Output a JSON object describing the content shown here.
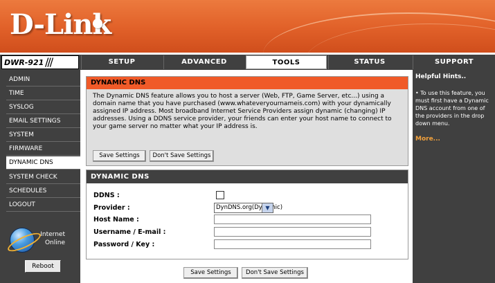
{
  "brand": {
    "logo": "D-Link"
  },
  "model": {
    "label": "DWR-921",
    "bars": "///"
  },
  "tabs": [
    {
      "label": "SETUP"
    },
    {
      "label": "ADVANCED"
    },
    {
      "label": "TOOLS"
    },
    {
      "label": "STATUS"
    },
    {
      "label": "SUPPORT"
    }
  ],
  "sidebar": {
    "items": [
      {
        "label": "ADMIN"
      },
      {
        "label": "TIME"
      },
      {
        "label": "SYSLOG"
      },
      {
        "label": "EMAIL SETTINGS"
      },
      {
        "label": "SYSTEM"
      },
      {
        "label": "FIRMWARE"
      },
      {
        "label": "DYNAMIC DNS"
      },
      {
        "label": "SYSTEM CHECK"
      },
      {
        "label": "SCHEDULES"
      },
      {
        "label": "LOGOUT"
      }
    ],
    "active": "DYNAMIC DNS",
    "internet_status_line1": "Internet",
    "internet_status_line2": "Online",
    "reboot_label": "Reboot"
  },
  "intro": {
    "title": "DYNAMIC DNS",
    "description": "The Dynamic DNS feature allows you to host a server (Web, FTP, Game Server, etc...) using a domain name that you have purchased (www.whateveryournameis.com) with your dynamically assigned IP address. Most broadband Internet Service Providers assign dynamic (changing) IP addresses. Using a DDNS service provider, your friends can enter your host name to connect to your game server no matter what your IP address is.",
    "save_label": "Save Settings",
    "dont_save_label": "Don't Save Settings"
  },
  "form": {
    "title": "DYNAMIC DNS",
    "ddns_label": "DDNS :",
    "ddns_checked": false,
    "provider_label": "Provider :",
    "provider_value": "DynDNS.org(Dynamic)",
    "host_label": "Host Name :",
    "host_value": "",
    "username_label": "Username / E-mail :",
    "username_value": "",
    "password_label": "Password / Key :",
    "password_value": ""
  },
  "bottom_buttons": {
    "save_label": "Save Settings",
    "dont_save_label": "Don't Save Settings"
  },
  "hints": {
    "title": "Helpful Hints..",
    "text": "• To use this feature, you must first have a Dynamic DNS account from one of the providers in the drop down menu.",
    "more": "More..."
  },
  "icons": {
    "globe": "internet-globe-icon",
    "dropdown": "chevron-down-icon"
  },
  "colors": {
    "brand_orange": "#e2622a",
    "header_orange": "#f05a28",
    "nav_dark": "#404040",
    "more_link": "#f2a13c"
  }
}
